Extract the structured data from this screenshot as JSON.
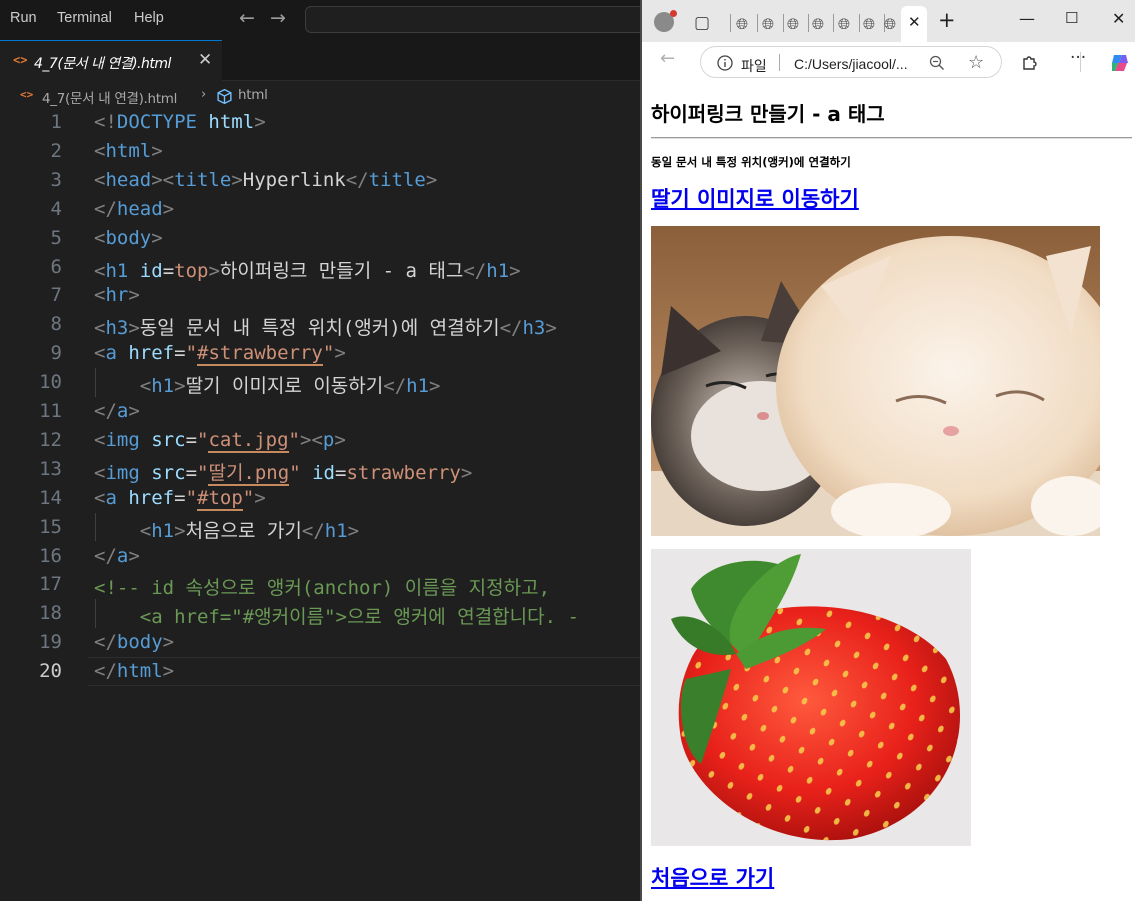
{
  "vscode": {
    "menu": [
      "Run",
      "Terminal",
      "Help"
    ],
    "tab": {
      "label": "4_7(문서 내 연결).html"
    },
    "breadcrumb": {
      "file": "4_7(문서 내 연결).html",
      "symbol": "html"
    },
    "active_line": 20,
    "lines": [
      [
        [
          "p",
          "<!"
        ],
        [
          "t",
          "DOCTYPE"
        ],
        [
          "w",
          " "
        ],
        [
          "a",
          "html"
        ],
        [
          "p",
          ">"
        ]
      ],
      [
        [
          "p",
          "<"
        ],
        [
          "t",
          "html"
        ],
        [
          "p",
          ">"
        ]
      ],
      [
        [
          "p",
          "<"
        ],
        [
          "t",
          "head"
        ],
        [
          "p",
          "><"
        ],
        [
          "t",
          "title"
        ],
        [
          "p",
          ">"
        ],
        [
          "w",
          "Hyperlink"
        ],
        [
          "p",
          "</"
        ],
        [
          "t",
          "title"
        ],
        [
          "p",
          ">"
        ]
      ],
      [
        [
          "p",
          "</"
        ],
        [
          "t",
          "head"
        ],
        [
          "p",
          ">"
        ]
      ],
      [
        [
          "p",
          "<"
        ],
        [
          "t",
          "body"
        ],
        [
          "p",
          ">"
        ]
      ],
      [
        [
          "p",
          "<"
        ],
        [
          "t",
          "h1"
        ],
        [
          "w",
          " "
        ],
        [
          "a",
          "id"
        ],
        [
          "w",
          "="
        ],
        [
          "s",
          "top"
        ],
        [
          "p",
          ">"
        ],
        [
          "w",
          "하이퍼링크 만들기 - a 태그"
        ],
        [
          "p",
          "</"
        ],
        [
          "t",
          "h1"
        ],
        [
          "p",
          ">"
        ]
      ],
      [
        [
          "p",
          "<"
        ],
        [
          "t",
          "hr"
        ],
        [
          "p",
          ">"
        ]
      ],
      [
        [
          "p",
          "<"
        ],
        [
          "t",
          "h3"
        ],
        [
          "p",
          ">"
        ],
        [
          "w",
          "동일 문서 내 특정 위치(앵커)에 연결하기"
        ],
        [
          "p",
          "</"
        ],
        [
          "t",
          "h3"
        ],
        [
          "p",
          ">"
        ]
      ],
      [
        [
          "p",
          "<"
        ],
        [
          "t",
          "a"
        ],
        [
          "w",
          " "
        ],
        [
          "a",
          "href"
        ],
        [
          "w",
          "="
        ],
        [
          "s",
          "\""
        ],
        [
          "su",
          "#strawberry"
        ],
        [
          "s",
          "\""
        ],
        [
          "p",
          ">"
        ]
      ],
      [
        [
          "w",
          "    "
        ],
        [
          "p",
          "<"
        ],
        [
          "t",
          "h1"
        ],
        [
          "p",
          ">"
        ],
        [
          "w",
          "딸기 이미지로 이동하기"
        ],
        [
          "p",
          "</"
        ],
        [
          "t",
          "h1"
        ],
        [
          "p",
          ">"
        ]
      ],
      [
        [
          "p",
          "</"
        ],
        [
          "t",
          "a"
        ],
        [
          "p",
          ">"
        ]
      ],
      [
        [
          "p",
          "<"
        ],
        [
          "t",
          "img"
        ],
        [
          "w",
          " "
        ],
        [
          "a",
          "src"
        ],
        [
          "w",
          "="
        ],
        [
          "s",
          "\""
        ],
        [
          "su",
          "cat.jpg"
        ],
        [
          "s",
          "\""
        ],
        [
          "p",
          "><"
        ],
        [
          "t",
          "p"
        ],
        [
          "p",
          ">"
        ]
      ],
      [
        [
          "p",
          "<"
        ],
        [
          "t",
          "img"
        ],
        [
          "w",
          " "
        ],
        [
          "a",
          "src"
        ],
        [
          "w",
          "="
        ],
        [
          "s",
          "\""
        ],
        [
          "su",
          "딸기.png"
        ],
        [
          "s",
          "\""
        ],
        [
          "w",
          " "
        ],
        [
          "a",
          "id"
        ],
        [
          "w",
          "="
        ],
        [
          "s",
          "strawberry"
        ],
        [
          "p",
          ">"
        ]
      ],
      [
        [
          "p",
          "<"
        ],
        [
          "t",
          "a"
        ],
        [
          "w",
          " "
        ],
        [
          "a",
          "href"
        ],
        [
          "w",
          "="
        ],
        [
          "s",
          "\""
        ],
        [
          "su",
          "#top"
        ],
        [
          "s",
          "\""
        ],
        [
          "p",
          ">"
        ]
      ],
      [
        [
          "w",
          "    "
        ],
        [
          "p",
          "<"
        ],
        [
          "t",
          "h1"
        ],
        [
          "p",
          ">"
        ],
        [
          "w",
          "처음으로 가기"
        ],
        [
          "p",
          "</"
        ],
        [
          "t",
          "h1"
        ],
        [
          "p",
          ">"
        ]
      ],
      [
        [
          "p",
          "</"
        ],
        [
          "t",
          "a"
        ],
        [
          "p",
          ">"
        ]
      ],
      [
        [
          "c",
          "<!-- id 속성으로 앵커(anchor) 이름을 지정하고,"
        ]
      ],
      [
        [
          "c",
          "    <a href=\"#앵커이름\">으로 앵커에 연결합니다. -"
        ]
      ],
      [
        [
          "p",
          "</"
        ],
        [
          "t",
          "body"
        ],
        [
          "p",
          ">"
        ]
      ],
      [
        [
          "p",
          "</"
        ],
        [
          "t",
          "html"
        ],
        [
          "p",
          ">"
        ]
      ]
    ]
  },
  "browser": {
    "address_label": "파일",
    "url": "C:/Users/jiacool/...",
    "page": {
      "h1": "하이퍼링크 만들기 - a 태그",
      "h3": "동일 문서 내 특정 위치(앵커)에 연결하기",
      "link_to_strawberry": "딸기 이미지로 이동하기",
      "link_to_top": "처음으로 가기"
    },
    "images": [
      "cat-photo",
      "strawberry-photo"
    ]
  }
}
